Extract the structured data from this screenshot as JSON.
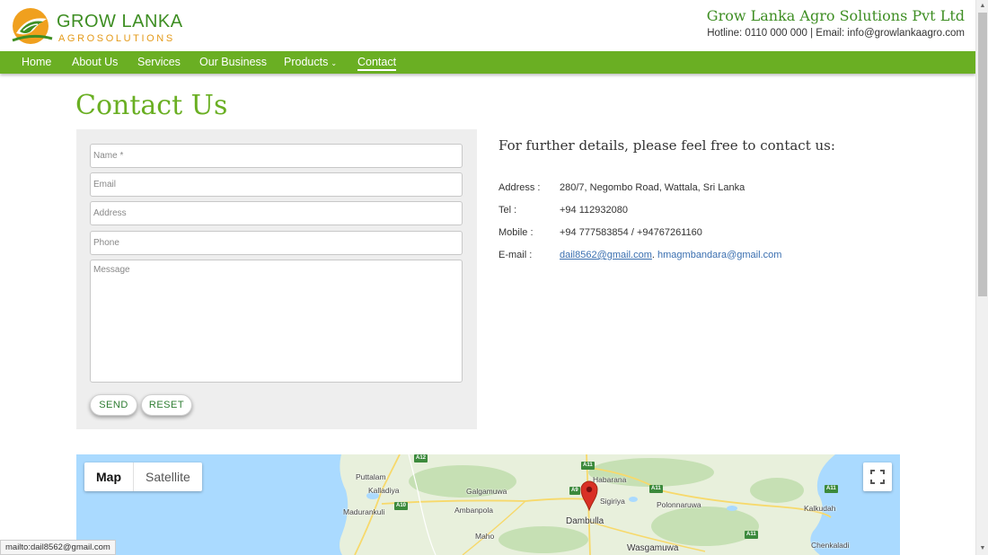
{
  "header": {
    "logo_title": "GROW LANKA",
    "logo_subtitle": "AGROSOLUTIONS",
    "company_name": "Grow Lanka Agro Solutions Pvt Ltd",
    "company_contact": "Hotline: 0110 000 000 | Email: info@growlankaagro.com"
  },
  "nav": {
    "items": [
      {
        "label": "Home"
      },
      {
        "label": "About Us"
      },
      {
        "label": "Services"
      },
      {
        "label": "Our Business"
      },
      {
        "label": "Products"
      },
      {
        "label": "Contact",
        "active": true
      }
    ]
  },
  "page": {
    "title": "Contact Us"
  },
  "form": {
    "name_placeholder": "Name *",
    "email_placeholder": "Email",
    "address_placeholder": "Address",
    "phone_placeholder": "Phone",
    "message_placeholder": "Message",
    "send_label": "SEND",
    "reset_label": "RESET"
  },
  "info": {
    "heading": "For further details, please feel free to contact us:",
    "address_label": "Address :",
    "address_value": "280/7, Negombo Road, Wattala, Sri Lanka",
    "tel_label": "Tel :",
    "tel_value": "+94 112932080",
    "mobile_label": "Mobile :",
    "mobile_value": "+94 777583854 / +94767261160",
    "email_label": "E-mail :",
    "email_1": "dail8562@gmail.com",
    "email_separator": ".",
    "email_2": "hmagmbandara@gmail.com"
  },
  "map": {
    "tab_map": "Map",
    "tab_satellite": "Satellite",
    "places": {
      "puttalam": "Puttalam",
      "kalladiya": "Kalladiya",
      "madurankuli": "Madurankuli",
      "galgamuwa": "Galgamuwa",
      "ambanpola": "Ambanpola",
      "maho": "Maho",
      "habarana": "Habarana",
      "sigiriya": "Sigiriya",
      "dambulla": "Dambulla",
      "polonnaruwa": "Polonnaruwa",
      "kalkudah": "Kalkudah",
      "wasgamuwa": "Wasgamuwa",
      "chenkaladi": "Chenkaladi"
    },
    "roads": {
      "a12": "A12",
      "a11_top": "A11",
      "a9": "A9",
      "a10": "A10",
      "a11_east": "A11",
      "a11_coast": "A11",
      "a11_mid": "A11"
    },
    "colors": {
      "land": "#e8f0dc",
      "water": "#aadaff",
      "forest": "#c6e0b4",
      "pin": "#d93025"
    }
  },
  "statusbar": {
    "text": "mailto:dail8562@gmail.com"
  },
  "colors": {
    "brand_green": "#6aaf23",
    "dark_green": "#3e8e23",
    "orange": "#e49a19"
  },
  "icons": {
    "logo": "sun-leaf-logo-icon",
    "dropdown": "chevron-down-icon",
    "fullscreen": "fullscreen-icon",
    "pin": "map-pin-icon"
  }
}
